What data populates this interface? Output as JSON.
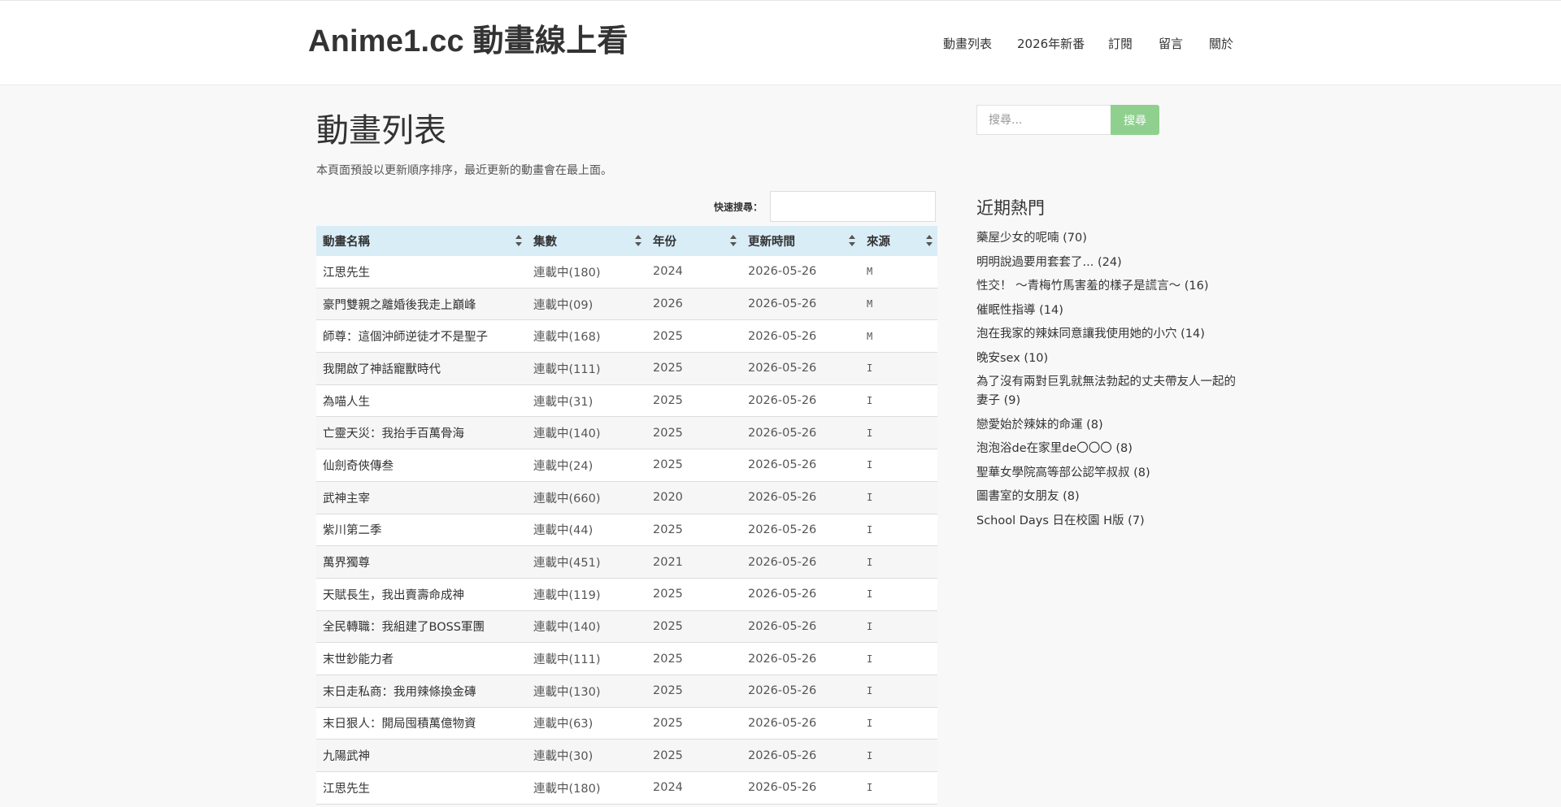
{
  "site": {
    "title": "Anime1.cc 動畫線上看"
  },
  "nav": [
    {
      "label": "動畫列表"
    },
    {
      "label": "2026年新番"
    },
    {
      "label": "訂閱"
    },
    {
      "label": "留言"
    },
    {
      "label": "關於"
    }
  ],
  "page": {
    "title": "動畫列表",
    "description": "本頁面預設以更新順序排序，最近更新的動畫會在最上面。"
  },
  "quick_search": {
    "label": "快速搜尋：",
    "value": ""
  },
  "table": {
    "headers": [
      "動畫名稱",
      "集數",
      "年份",
      "更新時間",
      "來源"
    ],
    "rows": [
      {
        "title": "江思先生",
        "episodes": "連載中(180)",
        "year": "2024",
        "updated": "2026-05-26",
        "source": "M"
      },
      {
        "title": "豪門雙親之離婚後我走上巔峰",
        "episodes": "連載中(09)",
        "year": "2026",
        "updated": "2026-05-26",
        "source": "M"
      },
      {
        "title": "師尊：這個沖師逆徒才不是聖子",
        "episodes": "連載中(168)",
        "year": "2025",
        "updated": "2026-05-26",
        "source": "M"
      },
      {
        "title": "我開啟了神話寵獸時代",
        "episodes": "連載中(111)",
        "year": "2025",
        "updated": "2026-05-26",
        "source": "I"
      },
      {
        "title": "為喵人生",
        "episodes": "連載中(31)",
        "year": "2025",
        "updated": "2026-05-26",
        "source": "I"
      },
      {
        "title": "亡靈天災：我抬手百萬骨海",
        "episodes": "連載中(140)",
        "year": "2025",
        "updated": "2026-05-26",
        "source": "I"
      },
      {
        "title": "仙劍奇俠傳叁",
        "episodes": "連載中(24)",
        "year": "2025",
        "updated": "2026-05-26",
        "source": "I"
      },
      {
        "title": "武神主宰",
        "episodes": "連載中(660)",
        "year": "2020",
        "updated": "2026-05-26",
        "source": "I"
      },
      {
        "title": "紫川第二季",
        "episodes": "連載中(44)",
        "year": "2025",
        "updated": "2026-05-26",
        "source": "I"
      },
      {
        "title": "萬界獨尊",
        "episodes": "連載中(451)",
        "year": "2021",
        "updated": "2026-05-26",
        "source": "I"
      },
      {
        "title": "天賦長生，我出賣壽命成神",
        "episodes": "連載中(119)",
        "year": "2025",
        "updated": "2026-05-26",
        "source": "I"
      },
      {
        "title": "全民轉職：我組建了BOSS軍團",
        "episodes": "連載中(140)",
        "year": "2025",
        "updated": "2026-05-26",
        "source": "I"
      },
      {
        "title": "末世鈔能力者",
        "episodes": "連載中(111)",
        "year": "2025",
        "updated": "2026-05-26",
        "source": "I"
      },
      {
        "title": "末日走私商：我用辣條換金磚",
        "episodes": "連載中(130)",
        "year": "2025",
        "updated": "2026-05-26",
        "source": "I"
      },
      {
        "title": "末日狠人：開局囤積萬億物資",
        "episodes": "連載中(63)",
        "year": "2025",
        "updated": "2026-05-26",
        "source": "I"
      },
      {
        "title": "九陽武神",
        "episodes": "連載中(30)",
        "year": "2025",
        "updated": "2026-05-26",
        "source": "I"
      },
      {
        "title": "江思先生",
        "episodes": "連載中(180)",
        "year": "2024",
        "updated": "2026-05-26",
        "source": "I"
      }
    ]
  },
  "sidebar": {
    "search": {
      "placeholder": "搜尋...",
      "button_label": "搜尋",
      "button_color": "#8fd08f"
    },
    "popular_title": "近期熱門",
    "popular": [
      {
        "title": "藥屋少女的呢喃",
        "count": "(70)"
      },
      {
        "title": "明明說過要用套套了...",
        "count": "(24)"
      },
      {
        "title": "性交！ 〜青梅竹馬害羞的樣子是謊言〜",
        "count": "(16)"
      },
      {
        "title": "催眠性指導",
        "count": "(14)"
      },
      {
        "title": "泡在我家的辣妹同意讓我使用她的小穴",
        "count": "(14)"
      },
      {
        "title": "晚安sex",
        "count": "(10)"
      },
      {
        "title": "為了沒有兩對巨乳就無法勃起的丈夫帶友人一起的妻子",
        "count": "(9)"
      },
      {
        "title": "戀愛始於辣妹的命運",
        "count": "(8)"
      },
      {
        "title": "泡泡浴de在家里de〇〇〇",
        "count": "(8)"
      },
      {
        "title": "聖華女學院高等部公認竿叔叔",
        "count": "(8)"
      },
      {
        "title": "圖書室的女朋友",
        "count": "(8)"
      },
      {
        "title": "School Days 日在校園 H版",
        "count": "(7)"
      }
    ]
  }
}
